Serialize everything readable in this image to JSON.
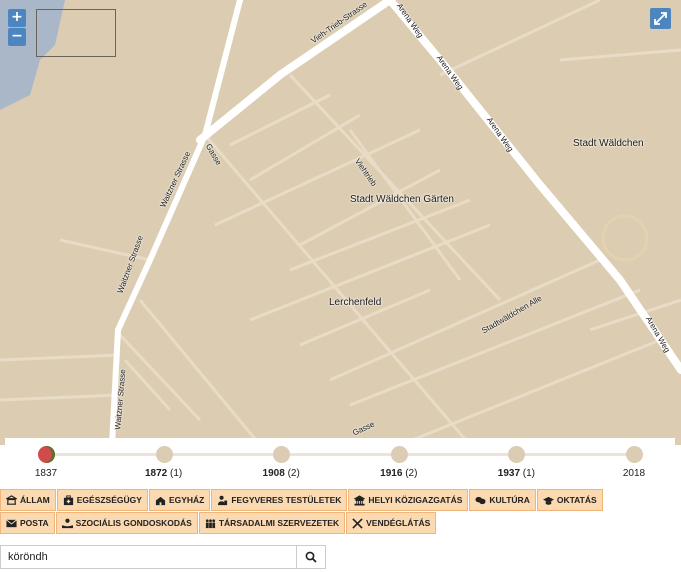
{
  "map": {
    "labels": {
      "stadt_waldchen": "Stadt Wäldchen",
      "stadt_waldchen_garten": "Stadt Wäldchen Gärten",
      "lerchenfeld": "Lerchenfeld"
    },
    "streets": {
      "vieh_trieb_strasse": "Vieh-Trieb-Strasse",
      "arena_weg": "Arena Weg",
      "waitzner_strasse": "Waitzner Strasse",
      "gasse": "Gasse",
      "viehtrieb": "Viehtrieb",
      "stadtwaldchen_allee": "Stadtwäldchen Alle"
    },
    "zoom_in": "+",
    "zoom_out": "−",
    "fullscreen_icon": "expand-icon"
  },
  "timeline": {
    "points": [
      {
        "year": "1837",
        "count": "",
        "active": true
      },
      {
        "year": "1872",
        "count": "(1)",
        "active": false
      },
      {
        "year": "1908",
        "count": "(2)",
        "active": false
      },
      {
        "year": "1916",
        "count": "(2)",
        "active": false
      },
      {
        "year": "1937",
        "count": "(1)",
        "active": false
      },
      {
        "year": "2018",
        "count": "",
        "active": false
      }
    ]
  },
  "categories": {
    "row1": [
      {
        "label": "ÁLLAM",
        "icon": "state-icon"
      },
      {
        "label": "EGÉSZSÉGÜGY",
        "icon": "medkit-icon"
      },
      {
        "label": "EGYHÁZ",
        "icon": "church-icon"
      },
      {
        "label": "FEGYVERES TESTÜLETEK",
        "icon": "officer-icon"
      },
      {
        "label": "HELYI KÖZIGAZGATÁS",
        "icon": "building-icon"
      },
      {
        "label": "KULTÚRA",
        "icon": "masks-icon"
      },
      {
        "label": "OKTATÁS",
        "icon": "graduation-cap-icon"
      }
    ],
    "row2": [
      {
        "label": "POSTA",
        "icon": "envelope-icon"
      },
      {
        "label": "SZOCIÁLIS GONDOSKODÁS",
        "icon": "care-icon"
      },
      {
        "label": "TÁRSADALMI SZERVEZETEK",
        "icon": "people-icon"
      },
      {
        "label": "VENDÉGLÁTÁS",
        "icon": "utensils-icon"
      }
    ]
  },
  "search": {
    "value": "köröndh",
    "button_icon": "search-icon"
  },
  "colors": {
    "map_background": "#dccdb2",
    "road": "#ffffff",
    "water": "#a9b7c9",
    "accent": "#4d86bf",
    "category_bg": "#fbd9b1",
    "timeline_active": "#d14b4b"
  }
}
